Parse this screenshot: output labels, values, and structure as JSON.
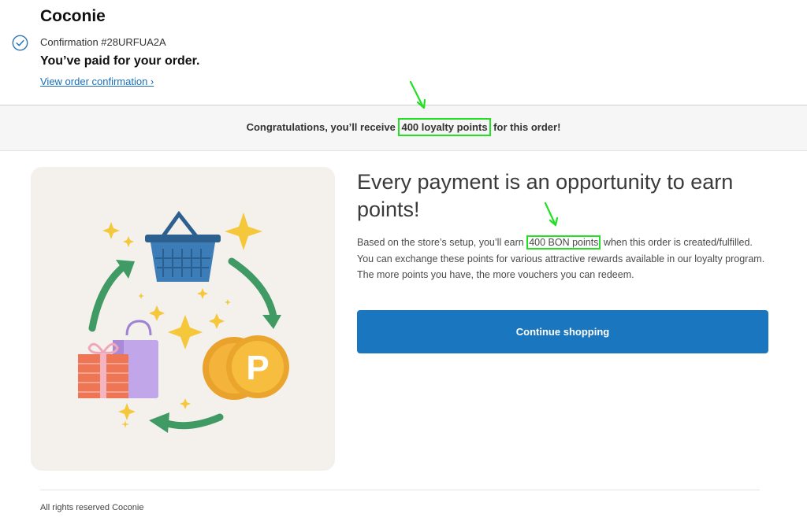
{
  "header": {
    "store_name": "Coconie",
    "confirmation_number": "Confirmation #28URFUA2A",
    "paid_title": "You’ve paid for your order.",
    "view_confirmation_link": "View order confirmation ›"
  },
  "banner": {
    "prefix": "Congratulations, you’ll receive ",
    "points": "400 loyalty points",
    "suffix": " for this order!"
  },
  "main": {
    "headline": "Every payment is an opportunity to earn points!",
    "description_prefix": "Based on the store’s setup, you’ll earn ",
    "description_points": "400 BON points",
    "description_suffix": " when this order is created/fulfilled. You can exchange these points for various attractive rewards available in our loyalty program. The more points you have, the more vouchers you can redeem.",
    "continue_button": "Continue shopping"
  },
  "illustration": {
    "coin_letter": "P"
  },
  "footer": {
    "text": "All rights reserved Coconie"
  },
  "colors": {
    "accent": "#1a76be",
    "highlight": "#22e022",
    "arrow_green": "#3f9a63",
    "coin": "#f2b233"
  },
  "icons": [
    "check-circle-icon",
    "annotation-arrow-icon",
    "shopping-basket-icon",
    "coin-icon",
    "gift-box-icon",
    "shopping-bag-icon",
    "sparkle-icon"
  ]
}
